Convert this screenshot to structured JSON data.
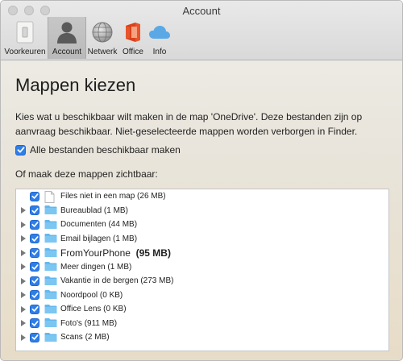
{
  "window": {
    "title": "Account"
  },
  "toolbar": {
    "items": [
      {
        "label": "Voorkeuren",
        "icon": "switch-icon"
      },
      {
        "label": "Account",
        "icon": "person-icon",
        "active": true
      },
      {
        "label": "Netwerk",
        "icon": "globe-icon"
      },
      {
        "label": "Office",
        "icon": "office-icon"
      },
      {
        "label": "Info",
        "icon": "cloud-icon"
      }
    ]
  },
  "main": {
    "heading": "Mappen kiezen",
    "description": "Kies wat u beschikbaar wilt maken in de map 'OneDrive'. Deze bestanden zijn op aanvraag beschikbaar. Niet-geselecteerde mappen worden verborgen in Finder.",
    "all_files_checkbox": {
      "label": "Alle bestanden beschikbaar maken",
      "checked": true
    },
    "folders_label": "Of maak deze mappen zichtbaar:",
    "folders": [
      {
        "name": "Files niet in een map (26 MB)",
        "type": "file",
        "checked": true,
        "expandable": false
      },
      {
        "name": "Bureaublad (1 MB)",
        "type": "folder",
        "checked": true,
        "expandable": true
      },
      {
        "name": "Documenten (44 MB)",
        "type": "folder",
        "checked": true,
        "expandable": true
      },
      {
        "name": "Email bijlagen (1 MB)",
        "type": "folder",
        "checked": true,
        "expandable": true
      },
      {
        "name": "FromYourPhone",
        "size": "(95 MB)",
        "type": "folder",
        "checked": true,
        "expandable": true,
        "emphasized": true
      },
      {
        "name": "Meer dingen (1 MB)",
        "type": "folder",
        "checked": true,
        "expandable": true
      },
      {
        "name": "Vakantie in de bergen (273 MB)",
        "type": "folder",
        "checked": true,
        "expandable": true
      },
      {
        "name": "Noordpool (0 KB)",
        "type": "folder",
        "checked": true,
        "expandable": true
      },
      {
        "name": "Office Lens (0 KB)",
        "type": "folder",
        "checked": true,
        "expandable": true
      },
      {
        "name": "Foto's (911 MB)",
        "type": "folder",
        "checked": true,
        "expandable": true
      },
      {
        "name": "Scans (2 MB)",
        "type": "folder",
        "checked": true,
        "expandable": true
      }
    ]
  },
  "colors": {
    "checkbox": "#2f7ee8",
    "folder": "#64b8ee",
    "office": "#e8552c",
    "cloud": "#5aa9e6"
  }
}
